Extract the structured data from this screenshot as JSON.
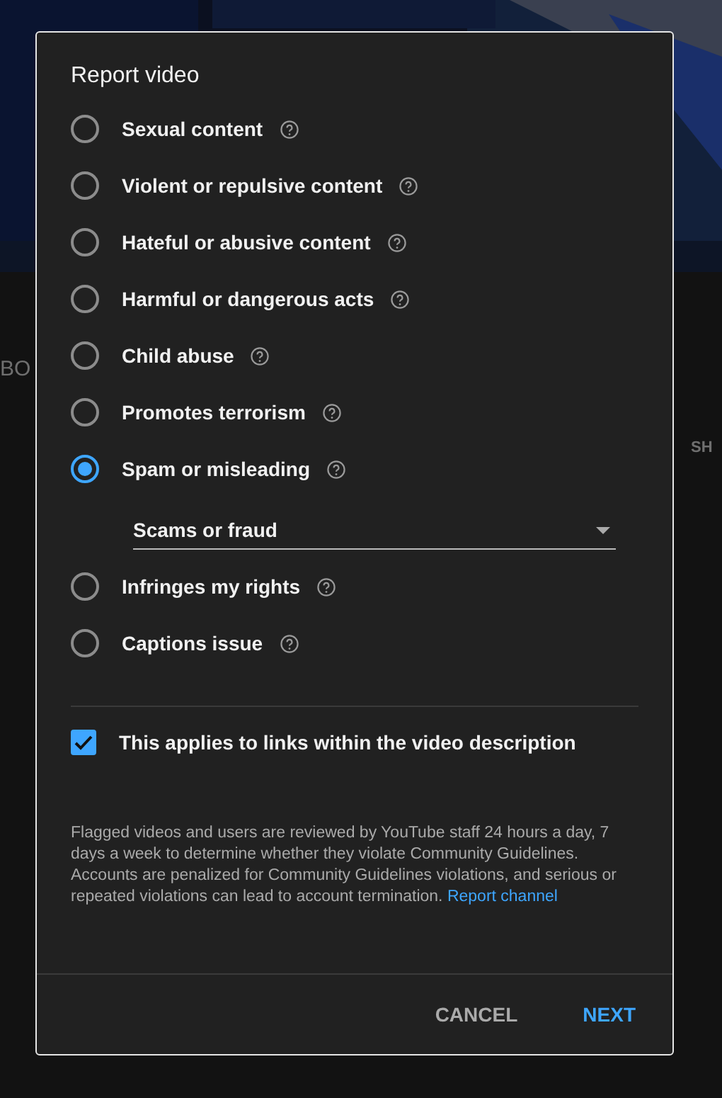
{
  "background": {
    "texts": [
      "BO",
      "SH"
    ]
  },
  "dialog": {
    "title": "Report video",
    "options": [
      {
        "label": "Sexual content",
        "selected": false
      },
      {
        "label": "Violent or repulsive content",
        "selected": false
      },
      {
        "label": "Hateful or abusive content",
        "selected": false
      },
      {
        "label": "Harmful or dangerous acts",
        "selected": false
      },
      {
        "label": "Child abuse",
        "selected": false
      },
      {
        "label": "Promotes terrorism",
        "selected": false
      },
      {
        "label": "Spam or misleading",
        "selected": true,
        "dropdown": {
          "value": "Scams or fraud"
        }
      },
      {
        "label": "Infringes my rights",
        "selected": false
      },
      {
        "label": "Captions issue",
        "selected": false
      }
    ],
    "checkbox": {
      "label": "This applies to links within the video description",
      "checked": true
    },
    "notice": "Flagged videos and users are reviewed by YouTube staff 24 hours a day, 7 days a week to determine whether they violate Community Guidelines. Accounts are penalized for Community Guidelines violations, and serious or repeated violations can lead to account termination.",
    "notice_link": "Report channel",
    "buttons": [
      {
        "label": "CANCEL",
        "kind": "secondary"
      },
      {
        "label": "NEXT",
        "kind": "primary"
      }
    ]
  }
}
